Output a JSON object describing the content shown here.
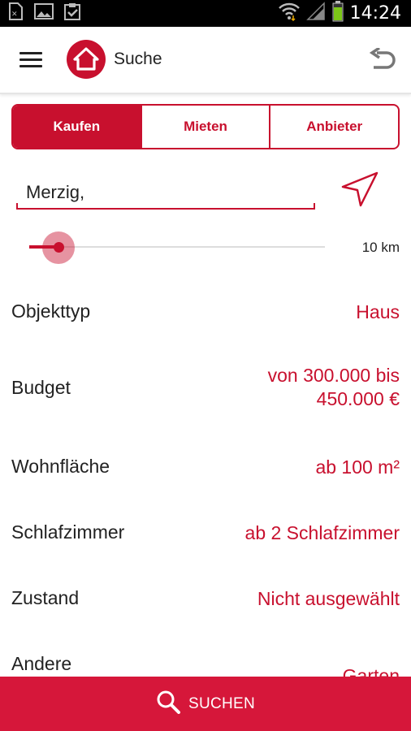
{
  "status_bar": {
    "time": "14:24",
    "icons": [
      "sim-icon",
      "image-icon",
      "clipboard-check-icon",
      "wifi-icon",
      "signal-icon",
      "battery-icon"
    ]
  },
  "app_bar": {
    "title": "Suche",
    "menu_icon": "hamburger-icon",
    "logo_icon": "house-icon",
    "back_icon": "undo-arrow-icon"
  },
  "tabs": [
    {
      "label": "Kaufen",
      "active": true
    },
    {
      "label": "Mieten",
      "active": false
    },
    {
      "label": "Anbieter",
      "active": false
    }
  ],
  "location": {
    "value": "Merzig,",
    "icon": "navigation-arrow-icon"
  },
  "radius": {
    "label": "10 km",
    "level_fraction": 0.1
  },
  "filters": [
    {
      "label": "Objekttyp",
      "value": "Haus"
    },
    {
      "label": "Budget",
      "value_line1": "von 300.000 bis",
      "value_line2": "450.000 €"
    },
    {
      "label": "Wohnfläche",
      "value": "ab 100 m²"
    },
    {
      "label": "Schlafzimmer",
      "value": "ab 2 Schlafzimmer"
    },
    {
      "label": "Zustand",
      "value": "Nicht ausgewählt"
    },
    {
      "label": "Andere",
      "value": "Garten"
    }
  ],
  "search_button": {
    "label": "SUCHEN",
    "icon": "search-icon"
  },
  "colors": {
    "accent": "#c8102e",
    "button": "#d6173a"
  }
}
